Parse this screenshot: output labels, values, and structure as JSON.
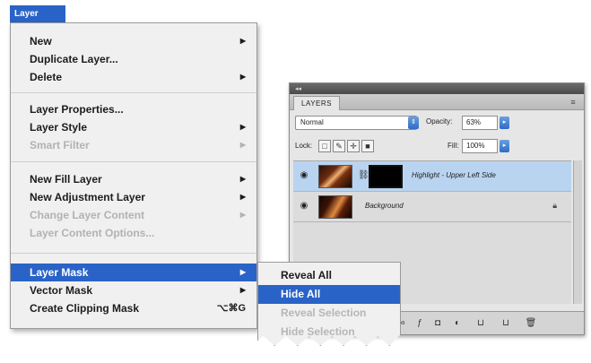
{
  "menubar": {
    "layer_label": "Layer"
  },
  "layer_menu": {
    "items": [
      {
        "label": "New",
        "arrow": "▶",
        "disabled": false
      },
      {
        "label": "Duplicate Layer...",
        "arrow": "",
        "disabled": false
      },
      {
        "label": "Delete",
        "arrow": "▶",
        "disabled": false
      },
      {
        "label": "Layer Properties...",
        "arrow": "",
        "disabled": false
      },
      {
        "label": "Layer Style",
        "arrow": "▶",
        "disabled": false
      },
      {
        "label": "Smart Filter",
        "arrow": "▶",
        "disabled": true
      },
      {
        "label": "New Fill Layer",
        "arrow": "▶",
        "disabled": false
      },
      {
        "label": "New Adjustment Layer",
        "arrow": "▶",
        "disabled": false
      },
      {
        "label": "Change Layer Content",
        "arrow": "▶",
        "disabled": true
      },
      {
        "label": "Layer Content Options...",
        "arrow": "",
        "disabled": true
      },
      {
        "label": "Layer Mask",
        "arrow": "▶",
        "disabled": false,
        "highlighted": true
      },
      {
        "label": "Vector Mask",
        "arrow": "▶",
        "disabled": false
      },
      {
        "label": "Create Clipping Mask",
        "shortcut": "⌥⌘G",
        "disabled": false
      }
    ]
  },
  "submenu": {
    "items": [
      {
        "label": "Reveal All",
        "disabled": false
      },
      {
        "label": "Hide All",
        "disabled": false,
        "highlighted": true
      },
      {
        "label": "Reveal Selection",
        "disabled": true
      },
      {
        "label": "Hide Selection",
        "disabled": true
      }
    ]
  },
  "layers_panel": {
    "tab_label": "LAYERS",
    "menu_icon": "≡",
    "blend_mode": "Normal",
    "opacity_label": "Opacity:",
    "opacity_value": "63%",
    "lock_label": "Lock:",
    "fill_label": "Fill:",
    "fill_value": "100%",
    "layers": [
      {
        "name": "Highlight - Upper Left Side",
        "selected": true,
        "has_mask": true
      },
      {
        "name": "Background",
        "selected": false,
        "has_mask": false,
        "locked": true
      }
    ]
  },
  "colors": {
    "highlight": "#2a63c7",
    "selected_layer": "#b9d4f0",
    "disabled_text": "#b2b2b2"
  }
}
